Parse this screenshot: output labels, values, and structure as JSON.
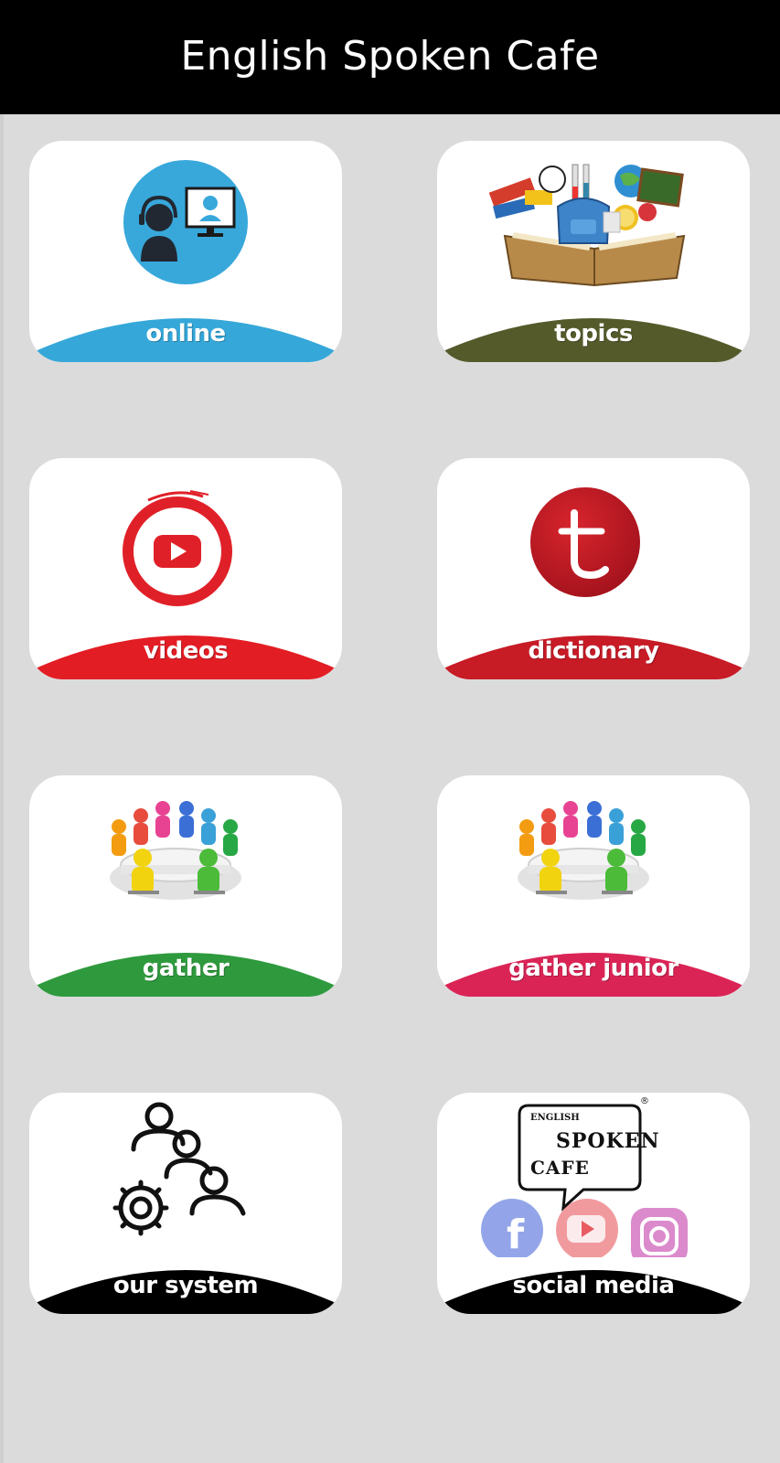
{
  "app": {
    "title": "English Spoken Cafe"
  },
  "menu": [
    {
      "id": "online",
      "label": "online",
      "icon": "online-tutor-icon",
      "color": "#35a7d9"
    },
    {
      "id": "topics",
      "label": "topics",
      "icon": "open-book-school-icon",
      "color": "#555a2b"
    },
    {
      "id": "videos",
      "label": "videos",
      "icon": "youtube-play-icon",
      "color": "#e31d24"
    },
    {
      "id": "dictionary",
      "label": "dictionary",
      "icon": "t-letter-icon",
      "color": "#c71b26"
    },
    {
      "id": "gather",
      "label": "gather",
      "icon": "round-table-people-icon",
      "color": "#2e9a3d"
    },
    {
      "id": "gather-junior",
      "label": "gather junior",
      "icon": "round-table-people-icon",
      "color": "#db2456"
    },
    {
      "id": "our-system",
      "label": "our system",
      "icon": "people-gear-icon",
      "color": "#000000"
    },
    {
      "id": "social-media",
      "label": "social media",
      "icon": "social-media-logo-icon",
      "color": "#000000"
    }
  ],
  "social_logo": {
    "line1": "ENGLISH",
    "line2": "SPOKEN",
    "line3": "CAFE",
    "mark": "®"
  }
}
